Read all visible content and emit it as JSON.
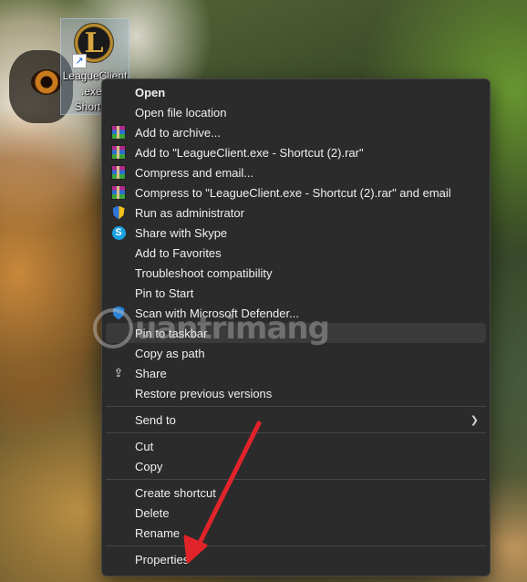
{
  "desktop": {
    "shortcut_label": "LeagueClient\n.exe -\nShortcut"
  },
  "context_menu": {
    "items": [
      {
        "label": "Open",
        "icon": "",
        "bold": true
      },
      {
        "label": "Open file location",
        "icon": ""
      },
      {
        "label": "Add to archive...",
        "icon": "winrar-icon"
      },
      {
        "label": "Add to \"LeagueClient.exe - Shortcut (2).rar\"",
        "icon": "winrar-icon"
      },
      {
        "label": "Compress and email...",
        "icon": "winrar-icon"
      },
      {
        "label": "Compress to \"LeagueClient.exe - Shortcut (2).rar\" and email",
        "icon": "winrar-icon"
      },
      {
        "label": "Run as administrator",
        "icon": "uac-shield-icon"
      },
      {
        "label": "Share with Skype",
        "icon": "skype-icon"
      },
      {
        "label": "Add to Favorites",
        "icon": ""
      },
      {
        "label": "Troubleshoot compatibility",
        "icon": ""
      },
      {
        "label": "Pin to Start",
        "icon": ""
      },
      {
        "label": "Scan with Microsoft Defender...",
        "icon": "defender-icon"
      },
      {
        "label": "Pin to taskbar",
        "icon": "",
        "highlighted": true
      },
      {
        "label": "Copy as path",
        "icon": ""
      },
      {
        "label": "Share",
        "icon": "share-icon"
      },
      {
        "label": "Restore previous versions",
        "icon": ""
      },
      {
        "label": "Send to",
        "icon": "",
        "submenu": true
      },
      {
        "label": "Cut",
        "icon": ""
      },
      {
        "label": "Copy",
        "icon": ""
      },
      {
        "label": "Create shortcut",
        "icon": ""
      },
      {
        "label": "Delete",
        "icon": ""
      },
      {
        "label": "Rename",
        "icon": ""
      },
      {
        "label": "Properties",
        "icon": ""
      }
    ]
  },
  "watermark": {
    "text": "uantrimang"
  },
  "colors": {
    "menu_background": "#2b2b2b",
    "menu_text": "#f0f0f0",
    "annotation_arrow": "#e0242a"
  }
}
